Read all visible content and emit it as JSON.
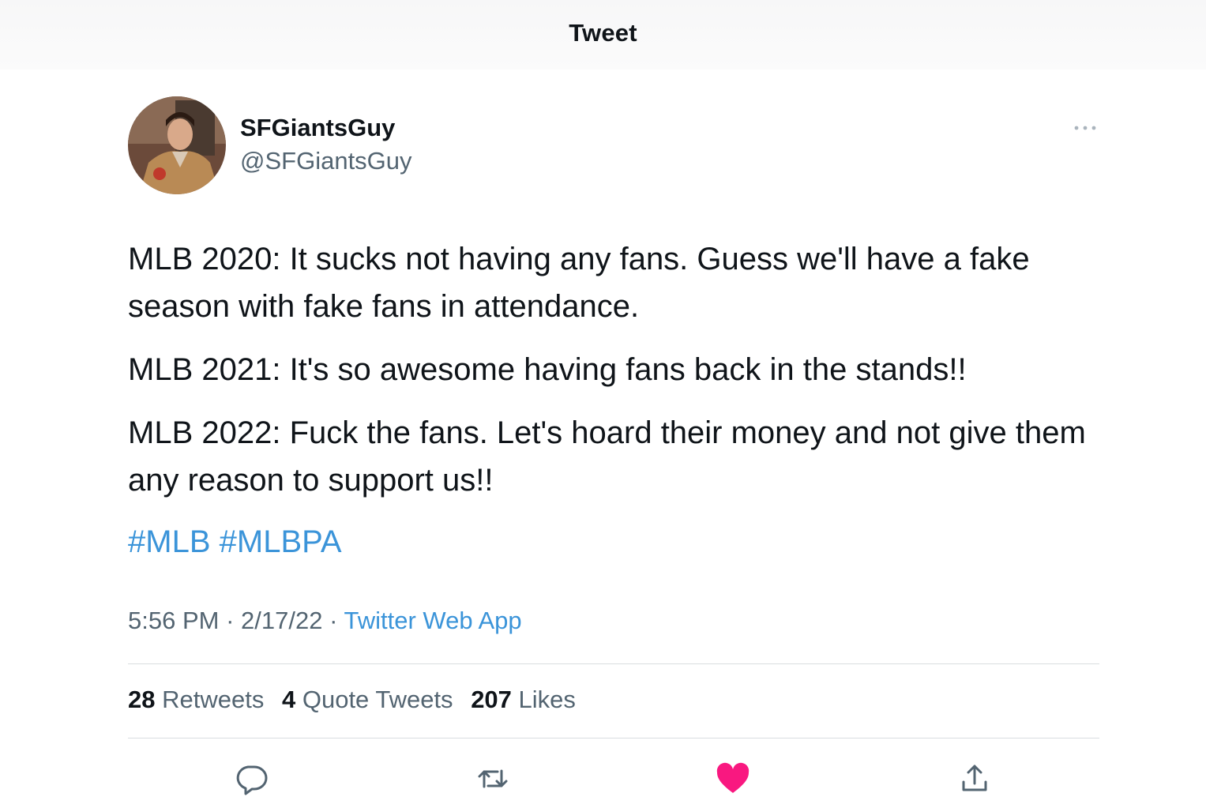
{
  "header": {
    "title": "Tweet"
  },
  "user": {
    "display_name": "SFGiantsGuy",
    "handle": "@SFGiantsGuy"
  },
  "tweet": {
    "paragraphs": [
      "MLB 2020: It sucks not having any fans. Guess we'll have a fake season with fake fans in attendance.",
      "MLB 2021: It's so awesome having fans back in the stands!!",
      "MLB 2022: Fuck the fans. Let's hoard their money and not give them any reason to support us!!"
    ],
    "hashtags": [
      "#MLB",
      "#MLBPA"
    ],
    "time": "5:56 PM",
    "date": "2/17/22",
    "separator": "·",
    "source": "Twitter Web App"
  },
  "stats": {
    "retweets": {
      "count": "28",
      "label": "Retweets"
    },
    "quotes": {
      "count": "4",
      "label": "Quote Tweets"
    },
    "likes": {
      "count": "207",
      "label": "Likes"
    }
  },
  "actions": [
    "reply-icon",
    "retweet-icon",
    "heart-icon",
    "share-icon"
  ],
  "colors": {
    "link": "#3b94d9",
    "like": "#f91880",
    "muted": "#536471",
    "text": "#0f1419"
  }
}
